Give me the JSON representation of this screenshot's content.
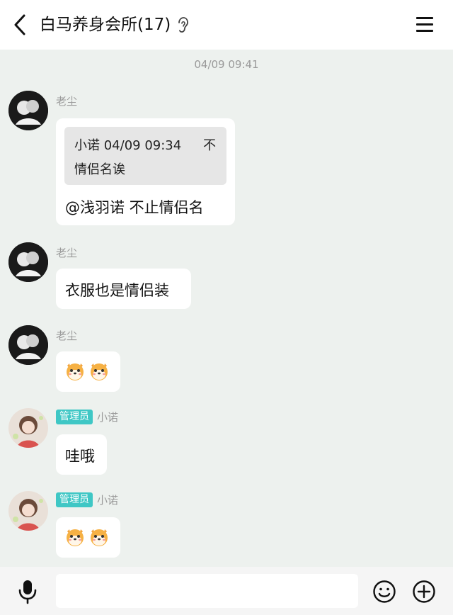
{
  "header": {
    "title": "白马养身会所(17)",
    "back_icon": "chevron-left-icon",
    "ear_icon": "ear-icon",
    "menu_icon": "hamburger-menu-icon"
  },
  "timestamp": "04/09 09:41",
  "messages": [
    {
      "sender": "老尘",
      "quote": {
        "author_time": "小诺 04/09 09:34",
        "text_line1_end": "不",
        "text_line2": "情侣名诶"
      },
      "text": "@浅羽诺 不止情侣名"
    },
    {
      "sender": "老尘",
      "text": "衣服也是情侣装"
    },
    {
      "sender": "老尘",
      "text": "",
      "emoji": [
        "shiba-dog-emoji",
        "shiba-dog-emoji"
      ]
    },
    {
      "badge": "管理员",
      "sender": "小诺",
      "text": "哇哦"
    },
    {
      "badge": "管理员",
      "sender": "小诺",
      "text": "",
      "emoji": [
        "shiba-dog-emoji",
        "shiba-dog-emoji"
      ]
    }
  ],
  "input_bar": {
    "placeholder": "",
    "mic_icon": "microphone-icon",
    "emoji_icon": "smiley-icon",
    "plus_icon": "plus-circle-icon"
  },
  "colors": {
    "background": "#edf1ee",
    "badge": "#3fc7c5",
    "bubble": "#ffffff",
    "quote_bg": "#e6e6e6"
  }
}
